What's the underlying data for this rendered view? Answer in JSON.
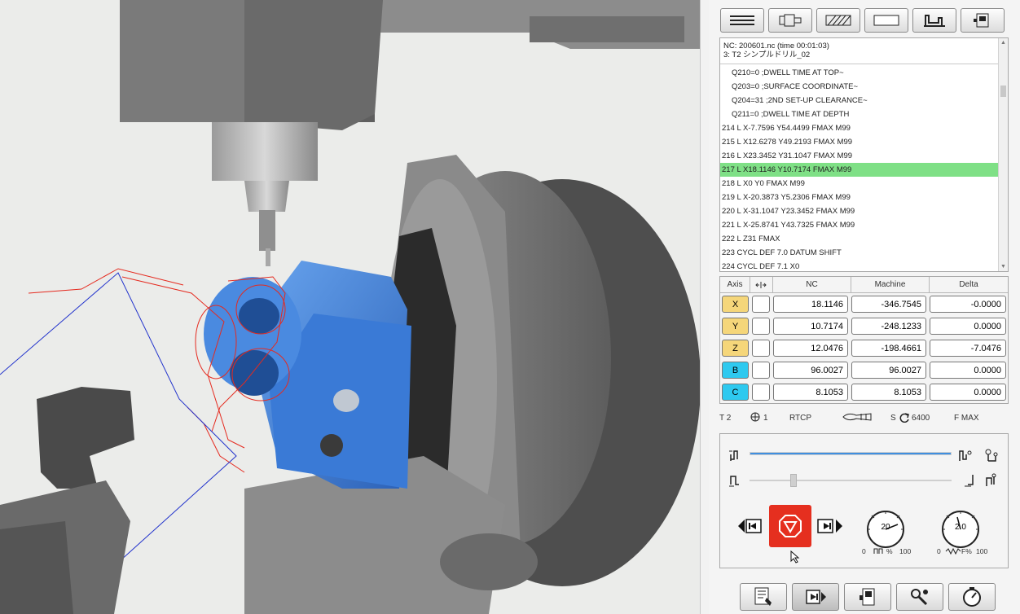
{
  "colors": {
    "highlight_line": "#7fe086",
    "linear_axis": "#f5d67a",
    "rotary_axis": "#2ec9ef",
    "stop_button": "#e52f1f",
    "feed_slider": "#3f8fe0",
    "workpiece": "#3a7ad6"
  },
  "toolbar": {
    "buttons": [
      {
        "name": "layers-icon"
      },
      {
        "name": "tool-holder-icon"
      },
      {
        "name": "stock-hatch-icon"
      },
      {
        "name": "blank-view-icon"
      },
      {
        "name": "fixture-icon"
      },
      {
        "name": "machine-cabinet-icon"
      }
    ]
  },
  "nc": {
    "header_line1": "NC: 200601.nc (time 00:01:03)",
    "header_line2": "3: T2 シンプルドリル_02",
    "lines": [
      {
        "text": "Q210=0 ;DWELL TIME AT TOP~",
        "indent": true
      },
      {
        "text": "Q203=0 ;SURFACE COORDINATE~",
        "indent": true
      },
      {
        "text": "Q204=31 ;2ND SET-UP CLEARANCE~",
        "indent": true
      },
      {
        "text": "Q211=0 ;DWELL TIME AT DEPTH",
        "indent": true
      },
      {
        "text": "214 L X-7.7596 Y54.4499 FMAX M99"
      },
      {
        "text": "215 L X12.6278 Y49.2193 FMAX M99"
      },
      {
        "text": "216 L X23.3452 Y31.1047 FMAX M99"
      },
      {
        "text": "217 L X18.1146 Y10.7174 FMAX M99",
        "active": true
      },
      {
        "text": "218 L X0 Y0 FMAX M99"
      },
      {
        "text": "219 L X-20.3873 Y5.2306 FMAX M99"
      },
      {
        "text": "220 L X-31.1047 Y23.3452 FMAX M99"
      },
      {
        "text": "221 L X-25.8741 Y43.7325 FMAX M99"
      },
      {
        "text": "222 L Z31 FMAX"
      },
      {
        "text": "223 CYCL DEF 7.0 DATUM SHIFT"
      },
      {
        "text": "224 CYCL DEF 7.1 X0"
      }
    ]
  },
  "axes": {
    "headers": {
      "axis": "Axis",
      "nc": "NC",
      "machine": "Machine",
      "delta": "Delta"
    },
    "rows": [
      {
        "axis": "X",
        "nc": "18.1146",
        "machine": "-346.7545",
        "delta": "-0.0000",
        "kind": "linear"
      },
      {
        "axis": "Y",
        "nc": "10.7174",
        "machine": "-248.1233",
        "delta": "0.0000",
        "kind": "linear"
      },
      {
        "axis": "Z",
        "nc": "12.0476",
        "machine": "-198.4661",
        "delta": "-7.0476",
        "kind": "linear"
      },
      {
        "axis": "B",
        "nc": "96.0027",
        "machine": "96.0027",
        "delta": "0.0000",
        "kind": "rotary"
      },
      {
        "axis": "C",
        "nc": "8.1053",
        "machine": "8.1053",
        "delta": "0.0000",
        "kind": "rotary"
      }
    ]
  },
  "status": {
    "tool": "T 2",
    "origin": "1",
    "mode": "RTCP",
    "spindle_prefix": "S",
    "spindle": "6400",
    "feed": "F MAX"
  },
  "control": {
    "feed_dial": {
      "value": "20",
      "min": "0",
      "max": "100",
      "unit": "%"
    },
    "speed_dial": {
      "value": "2.0",
      "min": "0",
      "max": "100",
      "unit": "F%"
    },
    "feed_progress": 1.0,
    "step_progress": 0.2
  },
  "bottom_bar": {
    "buttons": [
      {
        "name": "nc-program-icon",
        "active": false
      },
      {
        "name": "step-forward-icon",
        "active": true
      },
      {
        "name": "machine-cabinet-icon",
        "active": false
      },
      {
        "name": "tool-settings-icon",
        "active": false
      },
      {
        "name": "measure-gauge-icon",
        "active": false
      }
    ]
  }
}
